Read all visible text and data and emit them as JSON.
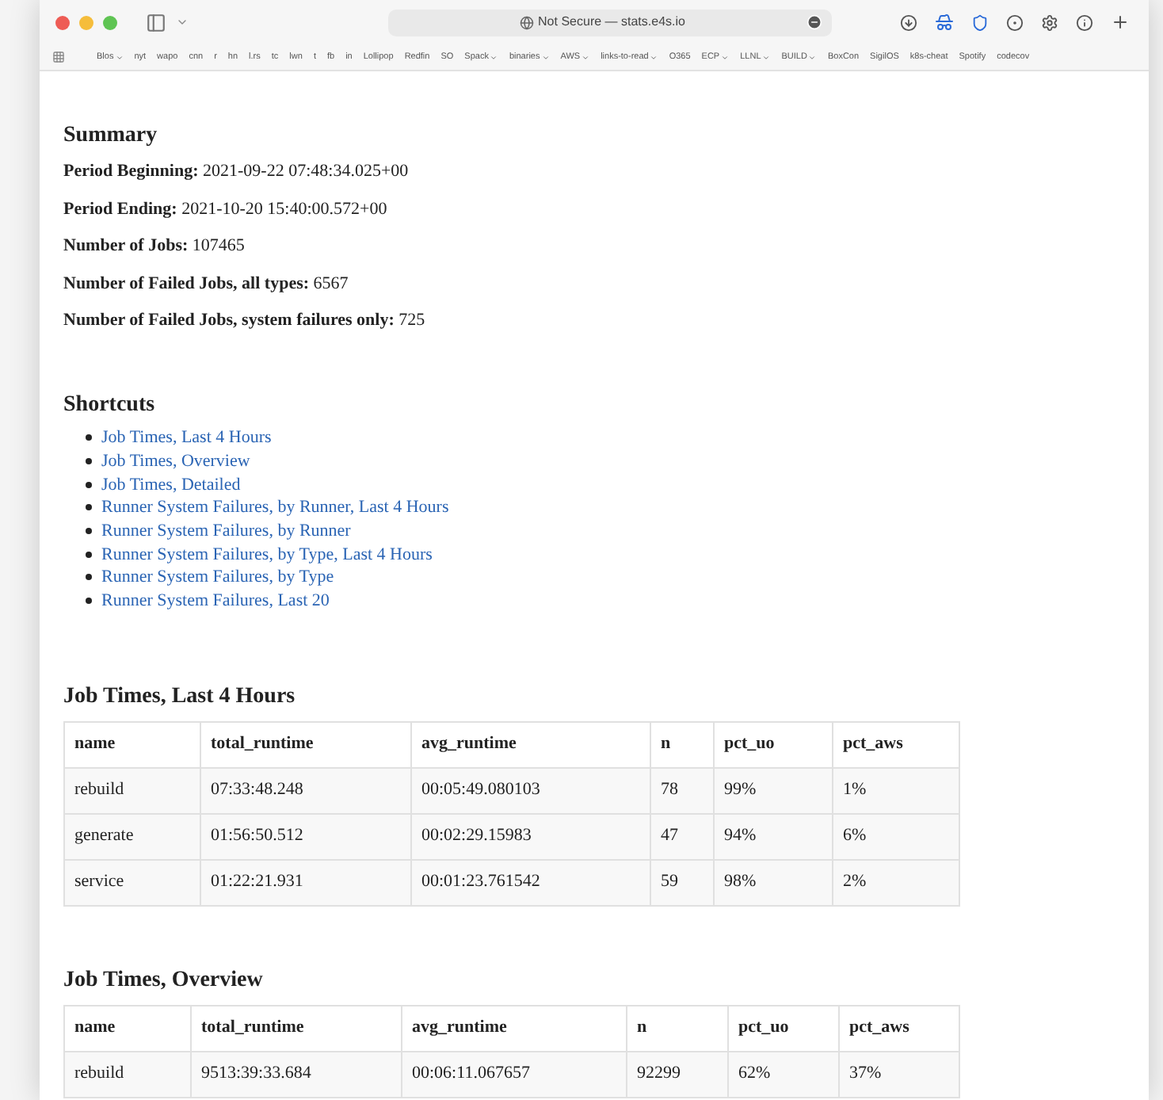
{
  "browser": {
    "address": "Not Secure — stats.e4s.io",
    "bookmarks": [
      {
        "label": "Blos",
        "dropdown": true
      },
      {
        "label": "nyt",
        "dropdown": false
      },
      {
        "label": "wapo",
        "dropdown": false
      },
      {
        "label": "cnn",
        "dropdown": false
      },
      {
        "label": "r",
        "dropdown": false
      },
      {
        "label": "hn",
        "dropdown": false
      },
      {
        "label": "l.rs",
        "dropdown": false
      },
      {
        "label": "tc",
        "dropdown": false
      },
      {
        "label": "lwn",
        "dropdown": false
      },
      {
        "label": "t",
        "dropdown": false
      },
      {
        "label": "fb",
        "dropdown": false
      },
      {
        "label": "in",
        "dropdown": false
      },
      {
        "label": "Lollipop",
        "dropdown": false
      },
      {
        "label": "Redfin",
        "dropdown": false
      },
      {
        "label": "SO",
        "dropdown": false
      },
      {
        "label": "Spack",
        "dropdown": true
      },
      {
        "label": "binaries",
        "dropdown": true
      },
      {
        "label": "AWS",
        "dropdown": true
      },
      {
        "label": "links-to-read",
        "dropdown": true
      },
      {
        "label": "O365",
        "dropdown": false
      },
      {
        "label": "ECP",
        "dropdown": true
      },
      {
        "label": "LLNL",
        "dropdown": true
      },
      {
        "label": "BUILD",
        "dropdown": true
      },
      {
        "label": "BoxCon",
        "dropdown": false
      },
      {
        "label": "SigilOS",
        "dropdown": false
      },
      {
        "label": "k8s-cheat",
        "dropdown": false
      },
      {
        "label": "Spotify",
        "dropdown": false
      },
      {
        "label": "codecov",
        "dropdown": false
      }
    ]
  },
  "summary": {
    "title": "Summary",
    "fields": [
      {
        "label": "Period Beginning:",
        "value": "2021-09-22 07:48:34.025+00"
      },
      {
        "label": "Period Ending:",
        "value": "2021-10-20 15:40:00.572+00"
      },
      {
        "label": "Number of Jobs:",
        "value": "107465"
      },
      {
        "label": "Number of Failed Jobs, all types:",
        "value": "6567"
      },
      {
        "label": "Number of Failed Jobs, system failures only:",
        "value": "725"
      }
    ]
  },
  "shortcuts": {
    "title": "Shortcuts",
    "links": [
      "Job Times, Last 4 Hours",
      "Job Times, Overview",
      "Job Times, Detailed",
      "Runner System Failures, by Runner, Last 4 Hours",
      "Runner System Failures, by Runner",
      "Runner System Failures, by Type, Last 4 Hours",
      "Runner System Failures, by Type",
      "Runner System Failures, Last 20"
    ]
  },
  "tables": [
    {
      "title": "Job Times, Last 4 Hours",
      "columns": [
        "name",
        "total_runtime",
        "avg_runtime",
        "n",
        "pct_uo",
        "pct_aws"
      ],
      "rows": [
        [
          "rebuild",
          "07:33:48.248",
          "00:05:49.080103",
          "78",
          "99%",
          "1%"
        ],
        [
          "generate",
          "01:56:50.512",
          "00:02:29.15983",
          "47",
          "94%",
          "6%"
        ],
        [
          "service",
          "01:22:21.931",
          "00:01:23.761542",
          "59",
          "98%",
          "2%"
        ]
      ]
    },
    {
      "title": "Job Times, Overview",
      "columns": [
        "name",
        "total_runtime",
        "avg_runtime",
        "n",
        "pct_uo",
        "pct_aws"
      ],
      "rows": [
        [
          "rebuild",
          "9513:39:33.684",
          "00:06:11.067657",
          "92299",
          "62%",
          "37%"
        ]
      ]
    }
  ]
}
